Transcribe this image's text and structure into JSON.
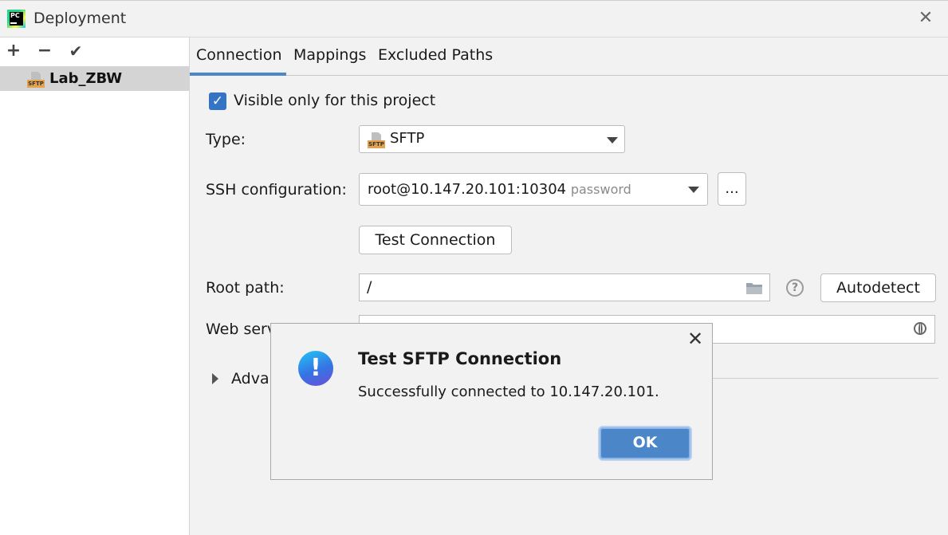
{
  "window": {
    "title": "Deployment"
  },
  "left_panel": {
    "toolbar": {
      "add": "+",
      "remove": "−",
      "apply": "✔"
    },
    "servers": [
      {
        "name": "Lab_ZBW",
        "icon": "sftp-icon",
        "selected": true
      }
    ]
  },
  "tabs": [
    {
      "label": "Connection",
      "active": true
    },
    {
      "label": "Mappings"
    },
    {
      "label": "Excluded Paths"
    }
  ],
  "form": {
    "visible_only_label": "Visible only for this project",
    "visible_only_checked": true,
    "type_label": "Type:",
    "type_value": "SFTP",
    "icon_badge": "SFTP",
    "ssh_label": "SSH configuration:",
    "ssh_value": "root@10.147.20.101:10304",
    "ssh_auth": "password",
    "ssh_more": "...",
    "test_connection": "Test Connection",
    "root_path_label": "Root path:",
    "root_path_value": "/",
    "help": "?",
    "autodetect": "Autodetect",
    "web_server_label_visible": "Web serv",
    "advanced_label_visible": "Advan"
  },
  "modal": {
    "title": "Test SFTP Connection",
    "message": "Successfully connected to 10.147.20.101.",
    "ok": "OK",
    "icon": "info-exclamation-icon"
  },
  "colors": {
    "accent": "#3574c4",
    "tab_underline": "#4a88c7",
    "ok_button": "#4a86c8",
    "selection": "#d4d4d4"
  }
}
